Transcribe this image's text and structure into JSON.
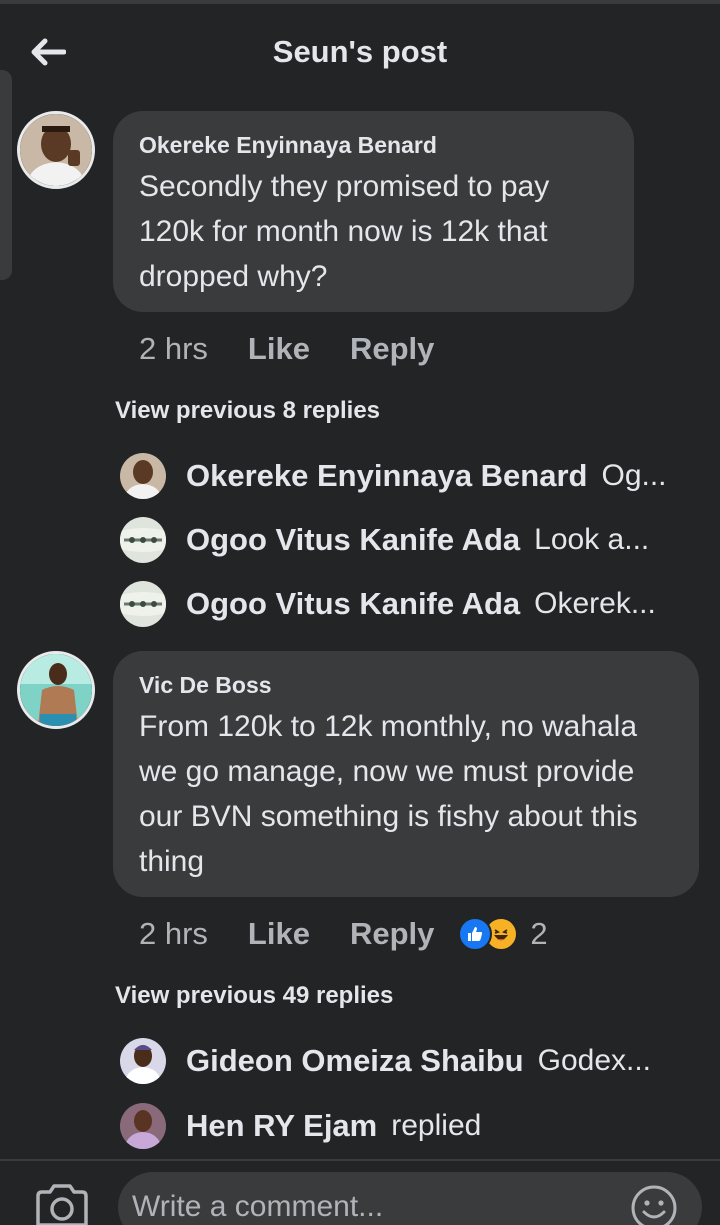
{
  "header": {
    "title": "Seun's post",
    "back_icon": "back-arrow-icon"
  },
  "comments": [
    {
      "author": "Okereke Enyinnaya Benard",
      "text": "Secondly they promised to pay 120k for month now is 12k that dropped why?",
      "time": "2 hrs",
      "like_label": "Like",
      "reply_label": "Reply",
      "view_previous": "View previous 8 replies",
      "replies": [
        {
          "name": "Okereke Enyinnaya Benard",
          "snippet": "Og..."
        },
        {
          "name": "Ogoo Vitus Kanife Ada",
          "snippet": "Look a..."
        },
        {
          "name": "Ogoo Vitus Kanife Ada",
          "snippet": "Okerek..."
        }
      ]
    },
    {
      "author": "Vic De Boss",
      "text": "From 120k to 12k monthly, no wahala we go manage, now we must provide our BVN something is fishy about this thing",
      "time": "2 hrs",
      "like_label": "Like",
      "reply_label": "Reply",
      "reactions": [
        "like-icon",
        "haha-icon"
      ],
      "reaction_count": "2",
      "view_previous": "View previous 49 replies",
      "replies": [
        {
          "name": "Gideon Omeiza Shaibu",
          "snippet": "Godex..."
        },
        {
          "name": "Hen RY Ejam",
          "snippet": "replied"
        }
      ]
    }
  ],
  "composer": {
    "placeholder": "Write a comment...",
    "camera_icon": "camera-icon",
    "emoji_icon": "emoji-icon"
  },
  "colors": {
    "background": "#232425",
    "bubble": "#3a3b3c",
    "text": "#e4e6eb",
    "secondary_text": "#b0b3b8",
    "like_blue": "#1877f2",
    "haha_yellow": "#f7b125"
  }
}
